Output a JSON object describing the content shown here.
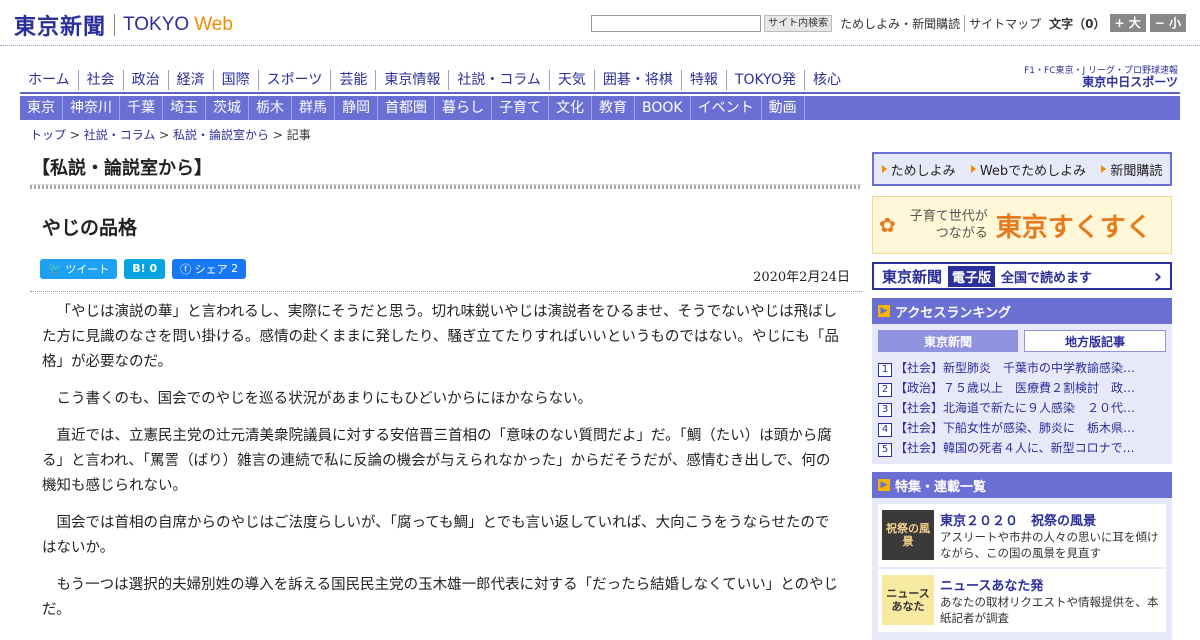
{
  "header": {
    "logo_jp": "東京新聞",
    "logo_en": "TOKYO",
    "logo_web": "Web",
    "search_placeholder": "",
    "search_button": "サイト内検索",
    "links": [
      "ためしよみ・新聞購読",
      "サイトマップ"
    ],
    "font_label": "文字（0）",
    "font_plus": "+ 大",
    "font_minus": "− 小"
  },
  "nav1": [
    "ホーム",
    "社会",
    "政治",
    "経済",
    "国際",
    "スポーツ",
    "芸能",
    "東京情報",
    "社説・コラム",
    "天気",
    "囲碁・将棋",
    "特報",
    "TOKYO発",
    "核心"
  ],
  "chunichi": {
    "line1": "F1・FC東京・J リーグ・プロ野球速報",
    "line2": "東京中日スポーツ"
  },
  "nav2": [
    "東京",
    "神奈川",
    "千葉",
    "埼玉",
    "茨城",
    "栃木",
    "群馬",
    "静岡",
    "首都圏",
    "暮らし",
    "子育て",
    "文化",
    "教育",
    "BOOK",
    "イベント",
    "動画"
  ],
  "breadcrumb": {
    "items": [
      "トップ",
      "社説・コラム",
      "私説・論説室から"
    ],
    "current": "記事",
    "sep": " > "
  },
  "article": {
    "section": "【私説・論説室から】",
    "title": "やじの品格",
    "date": "2020年2月24日",
    "share": {
      "tweet": "ツイート",
      "hatena": "B!",
      "hatena_count": "0",
      "facebook": "シェア",
      "facebook_count": "2"
    },
    "paragraphs": [
      "「やじは演説の華」と言われるし、実際にそうだと思う。切れ味鋭いやじは演説者をひるませ、そうでないやじは飛ばした方に見識のなさを問い掛ける。感情の赴くままに発したり、騒ぎ立てたりすればいいというものではない。やじにも「品格」が必要なのだ。",
      "こう書くのも、国会でのやじを巡る状況があまりにもひどいからにほかならない。",
      "直近では、立憲民主党の辻元清美衆院議員に対する安倍晋三首相の「意味のない質問だよ」だ。「鯛（たい）は頭から腐る」と言われ、「罵詈（ばり）雑言の連続で私に反論の機会が与えられなかった」からだそうだが、感情むき出しで、何の機知も感じられない。",
      "国会では首相の自席からのやじはご法度らしいが、「腐っても鯛」とでも言い返していれば、大向こうをうならせたのではないか。",
      "もう一つは選択的夫婦別姓の導入を訴える国民民主党の玉木雄一郎代表に対する「だったら結婚しなくていい」とのやじだ。"
    ]
  },
  "sidebar": {
    "nav": [
      "ためしよみ",
      "Webでためしよみ",
      "新聞購読"
    ],
    "sukusuku": {
      "line1": "子育て世代が",
      "line2": "つながる",
      "brand": "東京すくすく"
    },
    "denshi": {
      "name": "東京新聞",
      "badge": "電子版",
      "text": "全国で読めます",
      "arrow": "›"
    },
    "ranking": {
      "title": "アクセスランキング",
      "tabs": [
        "東京新聞",
        "地方版記事"
      ],
      "items": [
        "【社会】新型肺炎　千葉市の中学教諭感染…",
        "【政治】７５歳以上　医療費２割検討　政…",
        "【社会】北海道で新たに９人感染　２０代…",
        "【社会】下船女性が感染、肺炎に　栃木県…",
        "【社会】韓国の死者４人に、新型コロナで…"
      ]
    },
    "features": {
      "title": "特集・連載一覧",
      "items": [
        {
          "img": "祝祭の風景",
          "title": "東京２０２０　祝祭の風景",
          "desc": "アスリートや市井の人々の思いに耳を傾けながら、この国の風景を見直す"
        },
        {
          "img": "ニュースあなた",
          "title": "ニュースあなた発",
          "desc": "あなたの取材リクエストや情報提供を、本紙記者が調査"
        }
      ]
    }
  },
  "colors": {
    "brand": "#2b2f9b",
    "accent": "#f28b00",
    "nav": "#6a6fd4"
  }
}
